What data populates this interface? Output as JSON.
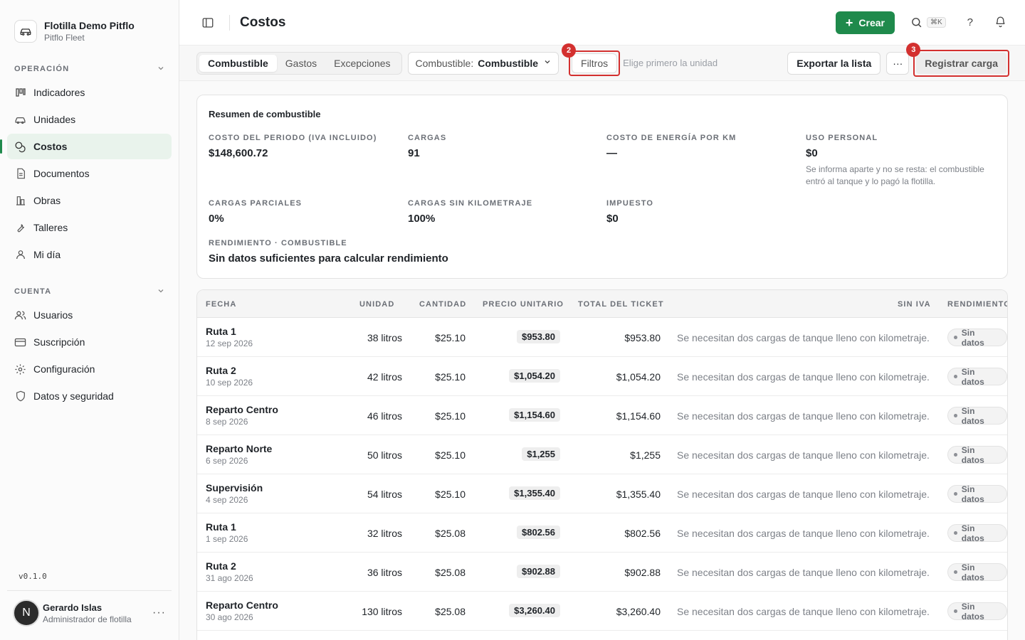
{
  "sidebar": {
    "org_name": "Flotilla Demo Pitflo",
    "org_sub": "Pitflo Fleet",
    "section_operacion": "OPERACIÓN",
    "section_cuenta": "CUENTA",
    "operacion_items": [
      {
        "label": "Indicadores",
        "icon": "chart-icon"
      },
      {
        "label": "Unidades",
        "icon": "car-icon"
      },
      {
        "label": "Costos",
        "icon": "coins-icon",
        "active": true
      },
      {
        "label": "Documentos",
        "icon": "document-icon"
      },
      {
        "label": "Obras",
        "icon": "building-icon"
      },
      {
        "label": "Talleres",
        "icon": "wrench-icon"
      },
      {
        "label": "Mi día",
        "icon": "user-icon"
      }
    ],
    "cuenta_items": [
      {
        "label": "Usuarios",
        "icon": "users-icon"
      },
      {
        "label": "Suscripción",
        "icon": "card-icon"
      },
      {
        "label": "Configuración",
        "icon": "gear-icon"
      },
      {
        "label": "Datos y seguridad",
        "icon": "shield-icon"
      }
    ],
    "version": "v0.1.0",
    "user": {
      "initial": "N",
      "name": "Gerardo Islas",
      "role": "Administrador de flotilla"
    }
  },
  "header": {
    "title": "Costos",
    "create_label": "Crear",
    "search_shortcut": "⌘K",
    "help": "?"
  },
  "toolbar": {
    "tabs": [
      "Combustible",
      "Gastos",
      "Excepciones"
    ],
    "active_tab": "Combustible",
    "select_label": "Combustible:",
    "select_value": "Combustible",
    "filters_label": "Filtros",
    "filters_badge": "2",
    "hint": "Elige primero la unidad",
    "export_label": "Exportar la lista",
    "more_label": "···",
    "register_label": "Registrar carga",
    "register_badge": "3"
  },
  "summary": {
    "title": "Resumen de combustible",
    "metrics": {
      "costo": {
        "label": "COSTO DEL PERIODO (IVA INCLUIDO)",
        "value": "$148,600.72"
      },
      "cargas": {
        "label": "CARGAS",
        "value": "91"
      },
      "energia": {
        "label": "COSTO DE ENERGÍA POR KM",
        "value": "—"
      },
      "personal": {
        "label": "USO PERSONAL",
        "value": "$0",
        "note": "Se informa aparte y no se resta: el combustible entró al tanque y lo pagó la flotilla."
      },
      "parciales": {
        "label": "CARGAS PARCIALES",
        "value": "0%"
      },
      "sin_km": {
        "label": "CARGAS SIN KILOMETRAJE",
        "value": "100%"
      },
      "impuesto": {
        "label": "IMPUESTO",
        "value": "$0"
      },
      "rendimiento": {
        "label": "RENDIMIENTO · COMBUSTIBLE",
        "value": "Sin datos suficientes para calcular rendimiento"
      }
    }
  },
  "table": {
    "headers": {
      "fecha": "FECHA",
      "unidad": "UNIDAD",
      "cantidad": "CANTIDAD",
      "precio": "PRECIO UNITARIO",
      "total": "TOTAL DEL TICKET",
      "sin_iva": "SIN IVA",
      "rendimiento": "RENDIMIENTO"
    },
    "rows": [
      {
        "unit": "Ruta 1",
        "date": "12 sep 2026",
        "qty": "38 litros",
        "price": "$25.10",
        "total_pill": "$953.80",
        "total": "$953.80",
        "msg": "Se necesitan dos cargas de tanque lleno con kilometraje.",
        "status": "Sin datos"
      },
      {
        "unit": "Ruta 2",
        "date": "10 sep 2026",
        "qty": "42 litros",
        "price": "$25.10",
        "total_pill": "$1,054.20",
        "total": "$1,054.20",
        "msg": "Se necesitan dos cargas de tanque lleno con kilometraje.",
        "status": "Sin datos"
      },
      {
        "unit": "Reparto Centro",
        "date": "8 sep 2026",
        "qty": "46 litros",
        "price": "$25.10",
        "total_pill": "$1,154.60",
        "total": "$1,154.60",
        "msg": "Se necesitan dos cargas de tanque lleno con kilometraje.",
        "status": "Sin datos"
      },
      {
        "unit": "Reparto Norte",
        "date": "6 sep 2026",
        "qty": "50 litros",
        "price": "$25.10",
        "total_pill": "$1,255",
        "total": "$1,255",
        "msg": "Se necesitan dos cargas de tanque lleno con kilometraje.",
        "status": "Sin datos"
      },
      {
        "unit": "Supervisión",
        "date": "4 sep 2026",
        "qty": "54 litros",
        "price": "$25.10",
        "total_pill": "$1,355.40",
        "total": "$1,355.40",
        "msg": "Se necesitan dos cargas de tanque lleno con kilometraje.",
        "status": "Sin datos"
      },
      {
        "unit": "Ruta 1",
        "date": "1 sep 2026",
        "qty": "32 litros",
        "price": "$25.08",
        "total_pill": "$802.56",
        "total": "$802.56",
        "msg": "Se necesitan dos cargas de tanque lleno con kilometraje.",
        "status": "Sin datos"
      },
      {
        "unit": "Ruta 2",
        "date": "31 ago 2026",
        "qty": "36 litros",
        "price": "$25.08",
        "total_pill": "$902.88",
        "total": "$902.88",
        "msg": "Se necesitan dos cargas de tanque lleno con kilometraje.",
        "status": "Sin datos"
      },
      {
        "unit": "Reparto Centro",
        "date": "30 ago 2026",
        "qty": "130 litros",
        "price": "$25.08",
        "total_pill": "$3,260.40",
        "total": "$3,260.40",
        "msg": "Se necesitan dos cargas de tanque lleno con kilometraje.",
        "status": "Sin datos"
      }
    ]
  },
  "colors": {
    "accent": "#1f8a4c",
    "highlight": "#d3302f"
  }
}
